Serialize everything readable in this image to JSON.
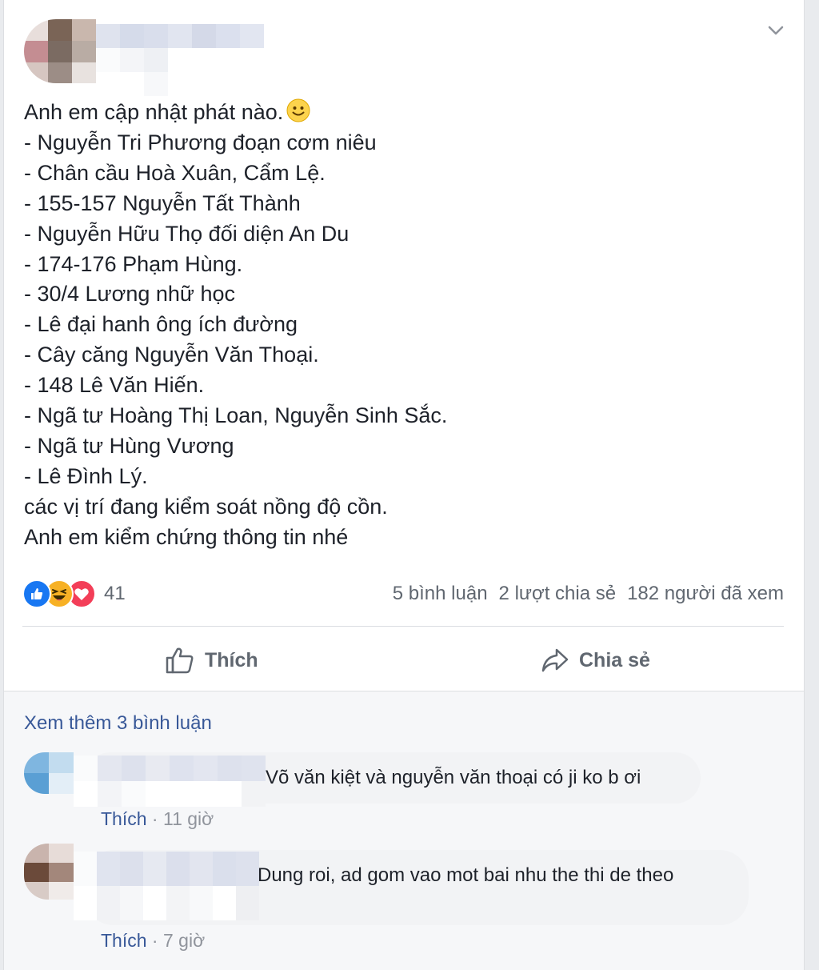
{
  "post": {
    "lines": [
      "Anh em cập nhật phát nào.",
      "- Nguyễn Tri Phương đoạn cơm niêu",
      "- Chân cầu Hoà Xuân, Cẩm Lệ.",
      "- 155-157 Nguyễn Tất Thành",
      "- Nguyễn Hữu Thọ đối diện An Du",
      "- 174-176 Phạm Hùng.",
      "- 30/4 Lương nhữ học",
      "- Lê đại hanh ông ích đường",
      "- Cây căng Nguyễn Văn Thoại.",
      "- 148 Lê Văn Hiến.",
      "- Ngã tư Hoàng Thị Loan, Nguyễn Sinh Sắc.",
      "- Ngã tư Hùng Vương",
      "- Lê Đình Lý.",
      "các vị trí đang kiểm soát nồng độ cồn.",
      "Anh em kiểm chứng thông tin nhé"
    ],
    "emoji": "slightly-smiling-face-icon"
  },
  "reactions": {
    "icons": [
      "like-icon",
      "haha-icon",
      "love-icon"
    ],
    "count": "41"
  },
  "stats": {
    "comments": "5 bình luận",
    "shares": "2 lượt chia sẻ",
    "views": "182 người đã xem"
  },
  "actions": {
    "like_label": "Thích",
    "share_label": "Chia sẻ"
  },
  "comments_section": {
    "view_more": "Xem thêm 3 bình luận",
    "comments": [
      {
        "text": "Võ văn kiệt và nguyễn văn thoại có ji ko b ơi",
        "like_label": "Thích",
        "separator": "·",
        "time": "11 giờ"
      },
      {
        "text": "Dung roi, ad gom vao mot bai nhu the thi de theo",
        "like_label": "Thích",
        "separator": "·",
        "time": "7 giờ"
      }
    ]
  },
  "colors": {
    "link": "#385898",
    "secondary_text": "#606770",
    "like_blue": "#1877f2",
    "haha_yellow": "#f7b125",
    "love_red": "#f33e58"
  }
}
